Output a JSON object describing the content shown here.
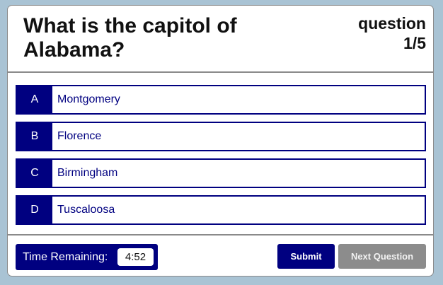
{
  "question": {
    "text": "What is the capitol of Alabama?",
    "counter_label": "question",
    "counter_value": "1/5"
  },
  "answers": [
    {
      "letter": "A",
      "text": "Montgomery"
    },
    {
      "letter": "B",
      "text": "Florence"
    },
    {
      "letter": "C",
      "text": "Birmingham"
    },
    {
      "letter": "D",
      "text": "Tuscaloosa"
    }
  ],
  "timer": {
    "label": "Time Remaining:",
    "value": "4:52"
  },
  "buttons": {
    "submit": "Submit",
    "next": "Next Question"
  },
  "colors": {
    "accent": "#000080",
    "disabled": "#8c8c8c",
    "page_background": "#a9c3d4"
  }
}
